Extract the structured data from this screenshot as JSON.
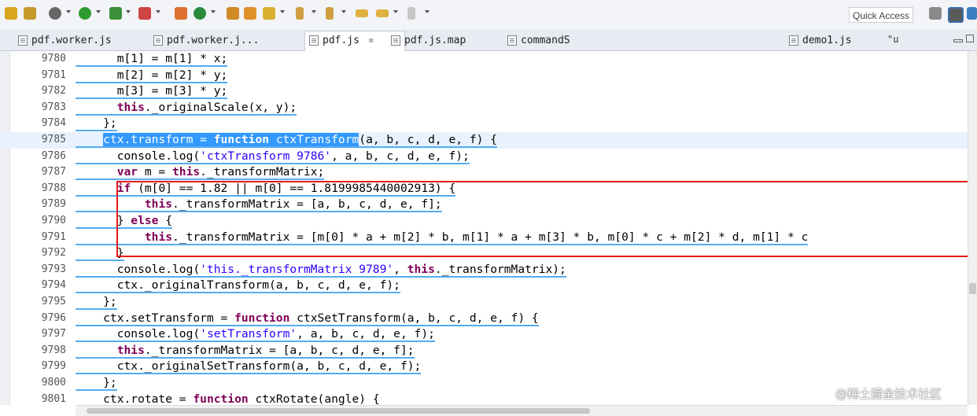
{
  "toolbar": {
    "quick_access_label": "Quick Access"
  },
  "tabs": [
    {
      "label": "pdf.worker.js",
      "active": false
    },
    {
      "label": "pdf.worker.j...",
      "active": false
    },
    {
      "label": "pdf.js",
      "active": true,
      "close": "⌧"
    },
    {
      "label": "pdf.js.map",
      "active": false
    },
    {
      "label": "commandS",
      "active": false
    },
    {
      "label": "demo1.js",
      "active": false
    }
  ],
  "tab_overflow": "\"u",
  "editor": {
    "current_line": "9785",
    "lines": [
      {
        "num": "9780",
        "html": "      m[1] = m[1] * x;"
      },
      {
        "num": "9781",
        "html": "      m[2] = m[2] * y;"
      },
      {
        "num": "9782",
        "html": "      m[3] = m[3] * y;"
      },
      {
        "num": "9783",
        "html": "      <span class=\"kw\">this</span>._originalScale(x, y);"
      },
      {
        "num": "9784",
        "html": "    };"
      },
      {
        "num": "9785",
        "html": "    <span class=\"sel\">ctx.transform = <span class=\"kw\">function</span> ctxTransform</span>(a, b, c, d, e, f) {"
      },
      {
        "num": "9786",
        "html": "      console.log(<span class=\"str\">'ctxTransform 9786'</span>, a, b, c, d, e, f);"
      },
      {
        "num": "9787",
        "html": "      <span class=\"kw\">var</span> m = <span class=\"kw\">this</span>._transformMatrix;"
      },
      {
        "num": "9788",
        "html": "      <span class=\"kw\">if</span> (m[0] == 1.82 || m[0] == 1.8199985440002913) {"
      },
      {
        "num": "9789",
        "html": "          <span class=\"kw\">this</span>._transformMatrix = [a, b, c, d, e, f];"
      },
      {
        "num": "9790",
        "html": "      } <span class=\"kw\">else</span> {"
      },
      {
        "num": "9791",
        "html": "          <span class=\"kw\">this</span>._transformMatrix = [m[0] * a + m[2] * b, m[1] * a + m[3] * b, m[0] * c + m[2] * d, m[1] * c"
      },
      {
        "num": "9792",
        "html": "      }"
      },
      {
        "num": "9793",
        "html": "      console.log(<span class=\"str\">'this._transformMatrix 9789'</span>, <span class=\"kw\">this</span>._transformMatrix);"
      },
      {
        "num": "9794",
        "html": "      ctx._originalTransform(a, b, c, d, e, f);"
      },
      {
        "num": "9795",
        "html": "    };"
      },
      {
        "num": "9796",
        "html": "    ctx.setTransform = <span class=\"kw\">function</span> ctxSetTransform(a, b, c, d, e, f) {"
      },
      {
        "num": "9797",
        "html": "      console.log(<span class=\"str\">'setTransform'</span>, a, b, c, d, e, f);"
      },
      {
        "num": "9798",
        "html": "      <span class=\"kw\">this</span>._transformMatrix = [a, b, c, d, e, f];"
      },
      {
        "num": "9799",
        "html": "      ctx._originalSetTransform(a, b, c, d, e, f);"
      },
      {
        "num": "9800",
        "html": "    };"
      },
      {
        "num": "9801",
        "html": "    ctx.rotate = <span class=\"kw\">function</span> ctxRotate(angle) {"
      }
    ]
  },
  "watermark": "@稀土掘金技术社区"
}
